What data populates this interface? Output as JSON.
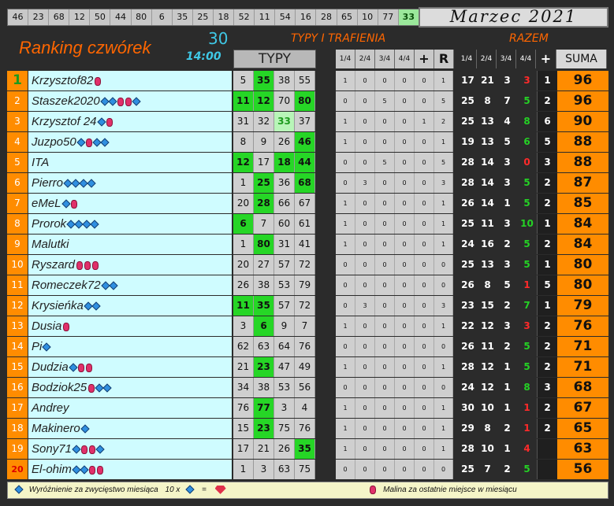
{
  "drawn_numbers": [
    "46",
    "23",
    "68",
    "12",
    "50",
    "44",
    "80",
    "6",
    "35",
    "25",
    "18",
    "52",
    "11",
    "54",
    "16",
    "28",
    "65",
    "10",
    "77",
    "33"
  ],
  "month": "Marzec 2021",
  "title": "Ranking czwórek",
  "round": "30",
  "time": "14:00",
  "section_typy": "TYPY I TRAFIENIA",
  "section_razem": "RAZEM",
  "typy_header": "TYPY",
  "mid_headers": [
    "1/4",
    "2/4",
    "3/4",
    "4/4",
    "+",
    "R",
    "1/4",
    "2/4",
    "3/4",
    "4/4",
    "+",
    "SUMA"
  ],
  "rows": [
    {
      "rank": "1",
      "name": "Krzysztof82",
      "icons": [
        "rb"
      ],
      "typy": [
        "5",
        "35",
        "38",
        "55"
      ],
      "hit": [
        0,
        1,
        0,
        0
      ],
      "mid": [
        "1",
        "0",
        "0",
        "0",
        "0",
        "1"
      ],
      "razem": [
        "17",
        "21",
        "3",
        "3",
        "1"
      ],
      "sum": "96"
    },
    {
      "rank": "2",
      "name": "Staszek2020",
      "icons": [
        "ds",
        "ds",
        "rb",
        "rb",
        "ds"
      ],
      "typy": [
        "11",
        "12",
        "70",
        "80"
      ],
      "hit": [
        1,
        1,
        0,
        1
      ],
      "mid": [
        "0",
        "0",
        "5",
        "0",
        "0",
        "5"
      ],
      "razem": [
        "25",
        "8",
        "7",
        "5",
        "2"
      ],
      "sum": "96"
    },
    {
      "rank": "3",
      "name": "Krzysztof 24",
      "icons": [
        "ds",
        "rb"
      ],
      "typy": [
        "31",
        "32",
        "33",
        "37"
      ],
      "hit": [
        0,
        0,
        2,
        0
      ],
      "mid": [
        "1",
        "0",
        "0",
        "0",
        "1",
        "2"
      ],
      "razem": [
        "25",
        "13",
        "4",
        "8",
        "6"
      ],
      "sum": "90"
    },
    {
      "rank": "4",
      "name": "Juzpo50",
      "icons": [
        "ds",
        "rb",
        "ds",
        "ds"
      ],
      "typy": [
        "8",
        "9",
        "26",
        "46"
      ],
      "hit": [
        0,
        0,
        0,
        1
      ],
      "mid": [
        "1",
        "0",
        "0",
        "0",
        "0",
        "1"
      ],
      "razem": [
        "19",
        "13",
        "5",
        "6",
        "5"
      ],
      "sum": "88"
    },
    {
      "rank": "5",
      "name": "ITA",
      "icons": [],
      "typy": [
        "12",
        "17",
        "18",
        "44"
      ],
      "hit": [
        1,
        0,
        1,
        1
      ],
      "mid": [
        "0",
        "0",
        "5",
        "0",
        "0",
        "5"
      ],
      "razem": [
        "28",
        "14",
        "3",
        "0",
        "3"
      ],
      "sum": "88"
    },
    {
      "rank": "6",
      "name": "Pierro",
      "icons": [
        "ds",
        "ds",
        "ds",
        "ds"
      ],
      "typy": [
        "1",
        "25",
        "36",
        "68"
      ],
      "hit": [
        0,
        1,
        0,
        1
      ],
      "mid": [
        "0",
        "3",
        "0",
        "0",
        "0",
        "3"
      ],
      "razem": [
        "28",
        "14",
        "3",
        "5",
        "2"
      ],
      "sum": "87"
    },
    {
      "rank": "7",
      "name": "eMeL",
      "icons": [
        "ds",
        "rb"
      ],
      "typy": [
        "20",
        "28",
        "66",
        "67"
      ],
      "hit": [
        0,
        1,
        0,
        0
      ],
      "mid": [
        "1",
        "0",
        "0",
        "0",
        "0",
        "1"
      ],
      "razem": [
        "26",
        "14",
        "1",
        "5",
        "2"
      ],
      "sum": "85"
    },
    {
      "rank": "8",
      "name": "Prorok",
      "icons": [
        "ds",
        "ds",
        "ds",
        "ds"
      ],
      "typy": [
        "6",
        "7",
        "60",
        "61"
      ],
      "hit": [
        1,
        0,
        0,
        0
      ],
      "mid": [
        "1",
        "0",
        "0",
        "0",
        "0",
        "1"
      ],
      "razem": [
        "25",
        "11",
        "3",
        "10",
        "1"
      ],
      "sum": "84"
    },
    {
      "rank": "9",
      "name": "Malutki",
      "icons": [],
      "typy": [
        "1",
        "80",
        "31",
        "41"
      ],
      "hit": [
        0,
        1,
        0,
        0
      ],
      "mid": [
        "1",
        "0",
        "0",
        "0",
        "0",
        "1"
      ],
      "razem": [
        "24",
        "16",
        "2",
        "5",
        "2"
      ],
      "sum": "84"
    },
    {
      "rank": "10",
      "name": "Ryszard",
      "icons": [
        "rb",
        "rb",
        "rb"
      ],
      "typy": [
        "20",
        "27",
        "57",
        "72"
      ],
      "hit": [
        0,
        0,
        0,
        0
      ],
      "mid": [
        "0",
        "0",
        "0",
        "0",
        "0",
        "0"
      ],
      "razem": [
        "25",
        "13",
        "3",
        "5",
        "1"
      ],
      "sum": "80"
    },
    {
      "rank": "11",
      "name": "Romeczek72",
      "icons": [
        "ds",
        "ds"
      ],
      "typy": [
        "26",
        "38",
        "53",
        "79"
      ],
      "hit": [
        0,
        0,
        0,
        0
      ],
      "mid": [
        "0",
        "0",
        "0",
        "0",
        "0",
        "0"
      ],
      "razem": [
        "26",
        "8",
        "5",
        "1",
        "5"
      ],
      "sum": "80"
    },
    {
      "rank": "12",
      "name": "Krysieńka",
      "icons": [
        "ds",
        "ds"
      ],
      "typy": [
        "11",
        "35",
        "57",
        "72"
      ],
      "hit": [
        1,
        1,
        0,
        0
      ],
      "mid": [
        "0",
        "3",
        "0",
        "0",
        "0",
        "3"
      ],
      "razem": [
        "23",
        "15",
        "2",
        "7",
        "1"
      ],
      "sum": "79"
    },
    {
      "rank": "13",
      "name": "Dusia",
      "icons": [
        "rb"
      ],
      "typy": [
        "3",
        "6",
        "9",
        "7"
      ],
      "hit": [
        0,
        1,
        0,
        0
      ],
      "mid": [
        "1",
        "0",
        "0",
        "0",
        "0",
        "1"
      ],
      "razem": [
        "22",
        "12",
        "3",
        "3",
        "2"
      ],
      "sum": "76"
    },
    {
      "rank": "14",
      "name": "Pi",
      "icons": [
        "ds"
      ],
      "typy": [
        "62",
        "63",
        "64",
        "76"
      ],
      "hit": [
        0,
        0,
        0,
        0
      ],
      "mid": [
        "0",
        "0",
        "0",
        "0",
        "0",
        "0"
      ],
      "razem": [
        "26",
        "11",
        "2",
        "5",
        "2"
      ],
      "sum": "71"
    },
    {
      "rank": "15",
      "name": "Dudzia",
      "icons": [
        "ds",
        "rb",
        "rb"
      ],
      "typy": [
        "21",
        "23",
        "47",
        "49"
      ],
      "hit": [
        0,
        1,
        0,
        0
      ],
      "mid": [
        "1",
        "0",
        "0",
        "0",
        "0",
        "1"
      ],
      "razem": [
        "28",
        "12",
        "1",
        "5",
        "2"
      ],
      "sum": "71"
    },
    {
      "rank": "16",
      "name": "Bodziok25",
      "icons": [
        "rb",
        "ds",
        "ds"
      ],
      "typy": [
        "34",
        "38",
        "53",
        "56"
      ],
      "hit": [
        0,
        0,
        0,
        0
      ],
      "mid": [
        "0",
        "0",
        "0",
        "0",
        "0",
        "0"
      ],
      "razem": [
        "24",
        "12",
        "1",
        "8",
        "3"
      ],
      "sum": "68"
    },
    {
      "rank": "17",
      "name": "Andrey",
      "icons": [],
      "typy": [
        "76",
        "77",
        "3",
        "4"
      ],
      "hit": [
        0,
        1,
        0,
        0
      ],
      "mid": [
        "1",
        "0",
        "0",
        "0",
        "0",
        "1"
      ],
      "razem": [
        "30",
        "10",
        "1",
        "1",
        "2"
      ],
      "sum": "67"
    },
    {
      "rank": "18",
      "name": "Makinero",
      "icons": [
        "ds"
      ],
      "typy": [
        "15",
        "23",
        "75",
        "76"
      ],
      "hit": [
        0,
        1,
        0,
        0
      ],
      "mid": [
        "1",
        "0",
        "0",
        "0",
        "0",
        "1"
      ],
      "razem": [
        "29",
        "8",
        "2",
        "1",
        "2"
      ],
      "sum": "65"
    },
    {
      "rank": "19",
      "name": "Sony71",
      "icons": [
        "ds",
        "rb",
        "rb",
        "ds"
      ],
      "typy": [
        "17",
        "21",
        "26",
        "35"
      ],
      "hit": [
        0,
        0,
        0,
        1
      ],
      "mid": [
        "1",
        "0",
        "0",
        "0",
        "0",
        "1"
      ],
      "razem": [
        "28",
        "10",
        "1",
        "4",
        ""
      ],
      "sum": "63"
    },
    {
      "rank": "20",
      "name": "El-ohim",
      "icons": [
        "ds",
        "ds",
        "rb",
        "rb"
      ],
      "typy": [
        "1",
        "3",
        "63",
        "75"
      ],
      "hit": [
        0,
        0,
        0,
        0
      ],
      "mid": [
        "0",
        "0",
        "0",
        "0",
        "0",
        "0"
      ],
      "razem": [
        "25",
        "7",
        "2",
        "5",
        ""
      ],
      "sum": "56"
    }
  ],
  "razem_colors": [
    [
      "w",
      "w",
      "w",
      "r",
      "w"
    ],
    [
      "w",
      "w",
      "w",
      "g",
      "w"
    ],
    [
      "w",
      "w",
      "w",
      "g",
      "w"
    ],
    [
      "w",
      "w",
      "w",
      "g",
      "w"
    ],
    [
      "w",
      "w",
      "w",
      "r",
      "w"
    ],
    [
      "w",
      "w",
      "w",
      "g",
      "w"
    ],
    [
      "w",
      "w",
      "w",
      "g",
      "w"
    ],
    [
      "w",
      "w",
      "w",
      "g",
      "w"
    ],
    [
      "w",
      "w",
      "w",
      "g",
      "w"
    ],
    [
      "w",
      "w",
      "w",
      "g",
      "w"
    ],
    [
      "w",
      "w",
      "w",
      "r",
      "w"
    ],
    [
      "w",
      "w",
      "w",
      "g",
      "w"
    ],
    [
      "w",
      "w",
      "w",
      "r",
      "w"
    ],
    [
      "w",
      "w",
      "w",
      "g",
      "w"
    ],
    [
      "w",
      "w",
      "w",
      "g",
      "w"
    ],
    [
      "w",
      "w",
      "w",
      "g",
      "w"
    ],
    [
      "w",
      "w",
      "w",
      "r",
      "w"
    ],
    [
      "w",
      "w",
      "w",
      "r",
      "w"
    ],
    [
      "w",
      "w",
      "w",
      "r",
      "w"
    ],
    [
      "w",
      "w",
      "w",
      "g",
      "w"
    ]
  ],
  "footer": {
    "left": "Wyróżnienie za zwycięstwo miesiąca",
    "times": "10 x",
    "equals": "=",
    "right": "Malina za ostatnie miejsce w miesiącu"
  },
  "colors": {
    "orange": "#ff8c00",
    "cyan_name_bg": "#cffcff",
    "hit_green": "#26d626",
    "title_orange": "#ff6600",
    "accent_cyan": "#3fc8e6"
  }
}
